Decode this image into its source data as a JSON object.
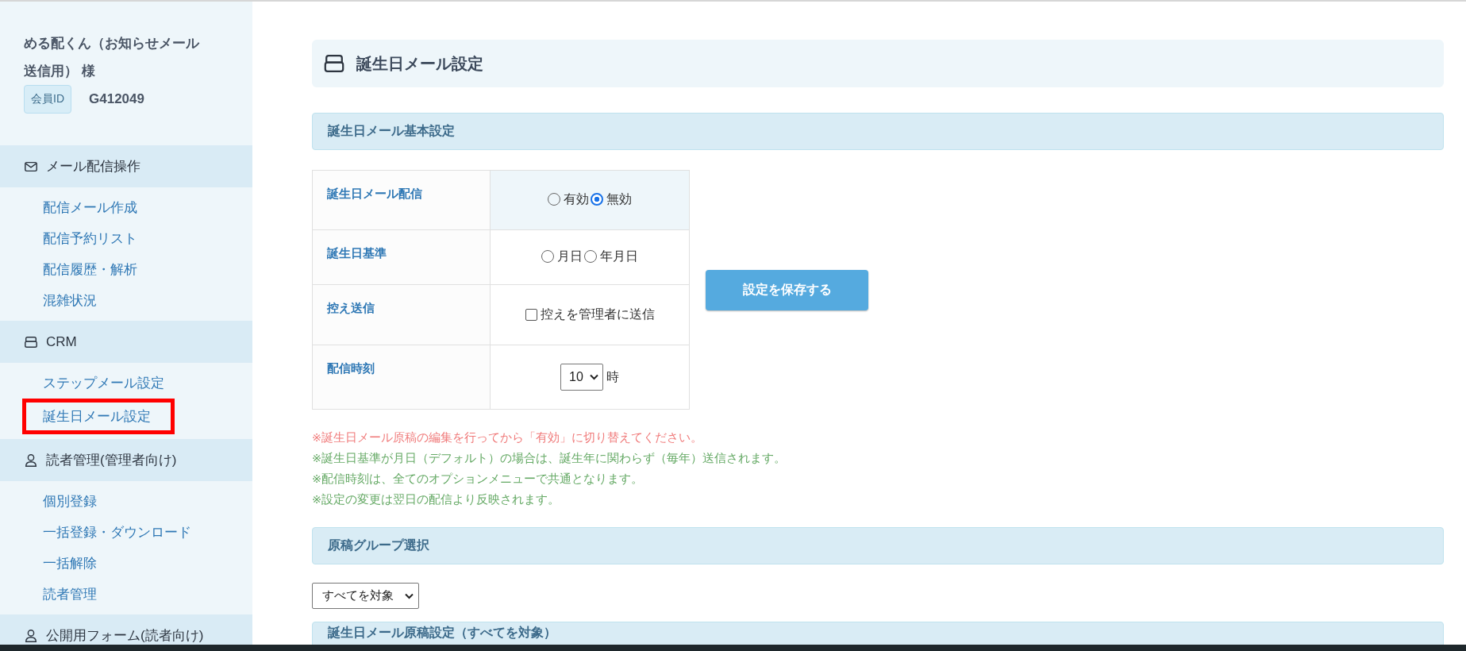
{
  "sidebar": {
    "user_name": "める配くん（お知らせメール送信用） 様",
    "member_id_label": "会員ID",
    "member_id": "G412049",
    "sections": [
      {
        "title": "メール配信操作",
        "kind": "mail",
        "items": [
          {
            "label": "配信メール作成",
            "selected": false
          },
          {
            "label": "配信予約リスト",
            "selected": false
          },
          {
            "label": "配信履歴・解析",
            "selected": false
          },
          {
            "label": "混雑状況",
            "selected": false
          }
        ]
      },
      {
        "title": "CRM",
        "kind": "drawer",
        "items": [
          {
            "label": "ステップメール設定",
            "selected": false
          },
          {
            "label": "誕生日メール設定",
            "selected": true
          }
        ]
      },
      {
        "title": "読者管理(管理者向け)",
        "kind": "person",
        "items": [
          {
            "label": "個別登録",
            "selected": false
          },
          {
            "label": "一括登録・ダウンロード",
            "selected": false
          },
          {
            "label": "一括解除",
            "selected": false
          },
          {
            "label": "読者管理",
            "selected": false
          }
        ]
      },
      {
        "title": "公開用フォーム(読者向け)",
        "kind": "person"
      }
    ]
  },
  "page": {
    "title": "誕生日メール設定",
    "basic_settings": {
      "title": "誕生日メール基本設定",
      "rows": [
        {
          "label": "誕生日メール配信",
          "kind": "radio",
          "highlighted": true,
          "options": [
            {
              "label": "有効",
              "selected": false
            },
            {
              "label": "無効",
              "selected": true
            }
          ]
        },
        {
          "label": "誕生日基準",
          "kind": "radio",
          "highlighted": false,
          "options": [
            {
              "label": "月日",
              "selected": false
            },
            {
              "label": "年月日",
              "selected": false
            }
          ]
        },
        {
          "label": "控え送信",
          "kind": "checkbox",
          "highlighted": false,
          "option": {
            "label": "控えを管理者に送信",
            "checked": false
          }
        },
        {
          "label": "配信時刻",
          "kind": "select",
          "highlighted": false,
          "value": "10",
          "suffix": "時"
        }
      ],
      "save_button": "設定を保存する",
      "notes": [
        {
          "kind": "warning",
          "text": "※誕生日メール原稿の編集を行ってから「有効」に切り替えてください。"
        },
        {
          "kind": "info",
          "text": "※誕生日基準が月日（デフォルト）の場合は、誕生年に関わらず（毎年）送信されます。"
        },
        {
          "kind": "info",
          "text": "※配信時刻は、全てのオプションメニューで共通となります。"
        },
        {
          "kind": "info",
          "text": "※設定の変更は翌日の配信より反映されます。"
        }
      ]
    },
    "group_select": {
      "title": "原稿グループ選択",
      "value": "すべてを対象"
    },
    "draft_settings": {
      "title": "誕生日メール原稿設定（すべてを対象）"
    }
  }
}
